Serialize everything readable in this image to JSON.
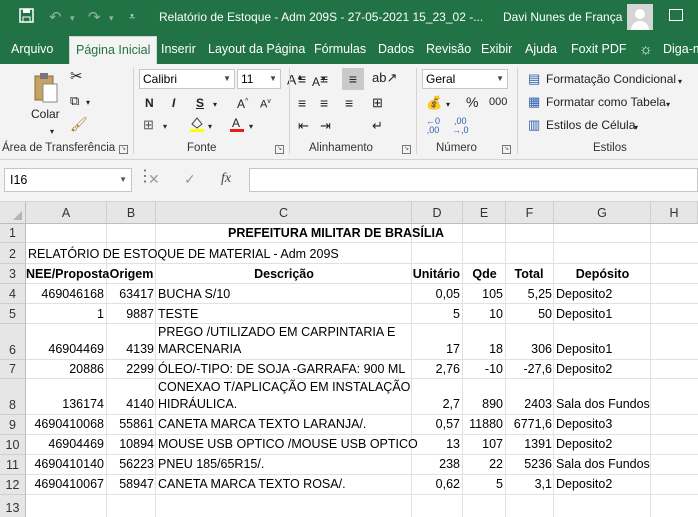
{
  "titlebar": {
    "title": "Relatório de Estoque - Adm 209S - 27-05-2021 15_23_02  -...",
    "user": "Davi Nunes de França",
    "save_icon": "save-icon",
    "undo_icon": "undo-icon",
    "redo_icon": "redo-icon"
  },
  "tabs": [
    "Arquivo",
    "Página Inicial",
    "Inserir",
    "Layout da Página",
    "Fórmulas",
    "Dados",
    "Revisão",
    "Exibir",
    "Ajuda",
    "Foxit PDF",
    "Diga-m"
  ],
  "ribbon": {
    "clipboard": {
      "paste_label": "Colar",
      "group_label": "Área de Transferência"
    },
    "font": {
      "name": "Calibri",
      "size": "11",
      "bold": "N",
      "italic": "I",
      "underline": "S",
      "group_label": "Fonte"
    },
    "alignment": {
      "group_label": "Alinhamento"
    },
    "number": {
      "format": "Geral",
      "group_label": "Número"
    },
    "styles": {
      "conditional": "Formatação Condicional",
      "table": "Formatar como Tabela",
      "cell": "Estilos de Célula",
      "group_label": "Estilos"
    }
  },
  "formula_bar": {
    "name_box": "I16",
    "fx": "fx",
    "formula": ""
  },
  "columns": [
    "A",
    "B",
    "C",
    "D",
    "E",
    "F",
    "G",
    "H"
  ],
  "rows": [
    "1",
    "2",
    "3",
    "4",
    "5",
    "6",
    "7",
    "8",
    "9",
    "10",
    "11",
    "12",
    "13"
  ],
  "sheet": {
    "title": "PREFEITURA MILITAR DE BRASÍLIA",
    "subtitle": "RELATÓRIO DE ESTOQUE DE MATERIAL - Adm 209S",
    "headers": [
      "NEE/Proposta",
      "Origem",
      "Descrição",
      "Unitário",
      "Qde",
      "Total",
      "Depósito"
    ],
    "records": [
      {
        "nee": "469046168",
        "origem": "63417",
        "desc1": "BUCHA S/10",
        "desc2": "",
        "unit": "0,05",
        "qde": "105",
        "total": "5,25",
        "dep": "Deposito2"
      },
      {
        "nee": "1",
        "origem": "9887",
        "desc1": "TESTE",
        "desc2": "",
        "unit": "5",
        "qde": "10",
        "total": "50",
        "dep": "Deposito1"
      },
      {
        "nee": "46904469",
        "origem": "4139",
        "desc1": "PREGO /UTILIZADO EM CARPINTARIA E",
        "desc2": "MARCENARIA",
        "unit": "17",
        "qde": "18",
        "total": "306",
        "dep": "Deposito1"
      },
      {
        "nee": "20886",
        "origem": "2299",
        "desc1": "ÓLEO/-TIPO: DE SOJA -GARRAFA: 900 ML",
        "desc2": "",
        "unit": "2,76",
        "qde": "-10",
        "total": "-27,6",
        "dep": "Deposito2"
      },
      {
        "nee": "136174",
        "origem": "4140",
        "desc1": "CONEXAO T/APLICAÇÃO EM INSTALAÇÃO",
        "desc2": "HIDRÁULICA.",
        "unit": "2,7",
        "qde": "890",
        "total": "2403",
        "dep": "Sala dos Fundos"
      },
      {
        "nee": "4690410068",
        "origem": "55861",
        "desc1": "CANETA MARCA TEXTO LARANJA/.",
        "desc2": "",
        "unit": "0,57",
        "qde": "11880",
        "total": "6771,6",
        "dep": "Deposito3"
      },
      {
        "nee": "46904469",
        "origem": "10894",
        "desc1": "MOUSE USB OPTICO /MOUSE USB OPTICO",
        "desc2": "",
        "unit": "13",
        "qde": "107",
        "total": "1391",
        "dep": "Deposito2"
      },
      {
        "nee": "4690410140",
        "origem": "56223",
        "desc1": "PNEU 185/65R15/.",
        "desc2": "",
        "unit": "238",
        "qde": "22",
        "total": "5236",
        "dep": "Sala dos Fundos"
      },
      {
        "nee": "4690410067",
        "origem": "58947",
        "desc1": "CANETA MARCA TEXTO ROSA/.",
        "desc2": "",
        "unit": "0,62",
        "qde": "5",
        "total": "3,1",
        "dep": "Deposito2"
      }
    ]
  },
  "colors": {
    "accent": "#217346",
    "ribbon_bg": "#f3f3f3",
    "header_bg": "#e6e6e6"
  }
}
